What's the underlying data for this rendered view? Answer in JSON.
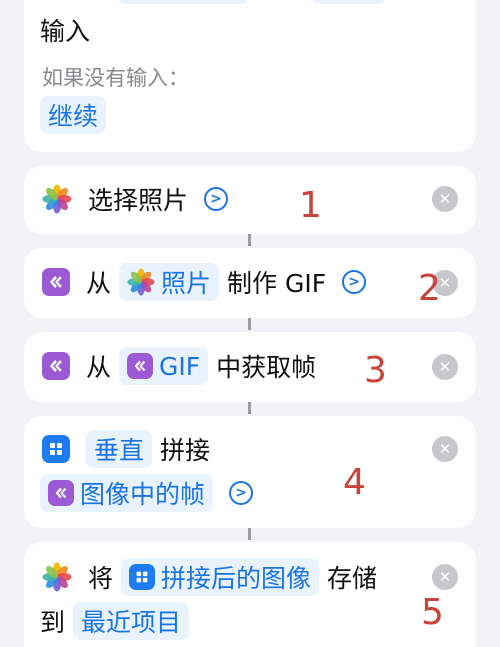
{
  "top_card": {
    "title": "输入",
    "subtitle": "如果没有输入：",
    "continue_label": "继续"
  },
  "steps": [
    {
      "icon": "photos-icon",
      "label": "选择照片",
      "annotation": "1"
    },
    {
      "icon": "gif-icon",
      "from_label": "从",
      "token": "照片",
      "token_icon": "photos-icon",
      "suffix": "制作 GIF",
      "annotation": "2"
    },
    {
      "icon": "gif-icon",
      "from_label": "从",
      "token": "GIF",
      "token_icon": "gif-icon",
      "suffix": "中获取帧",
      "annotation": "3"
    },
    {
      "icon": "grid-icon",
      "direction": "垂直",
      "action": "拼接",
      "token": "图像中的帧",
      "token_icon": "gif-icon",
      "annotation": "4"
    },
    {
      "icon": "photos-icon",
      "verb": "将",
      "token": "拼接后的图像",
      "token_icon": "grid-icon",
      "suffix": "存储",
      "to_label": "到",
      "destination": "最近项目",
      "annotation": "5"
    }
  ],
  "colors": {
    "background": "#f2f2f7",
    "accent": "#1a74e6",
    "token_bg": "#e9f3fd",
    "gif_purple": "#9b59d4",
    "grid_blue": "#1e7cf2",
    "annotation_red": "#c8443a",
    "close_gray": "#c7c7cc"
  }
}
